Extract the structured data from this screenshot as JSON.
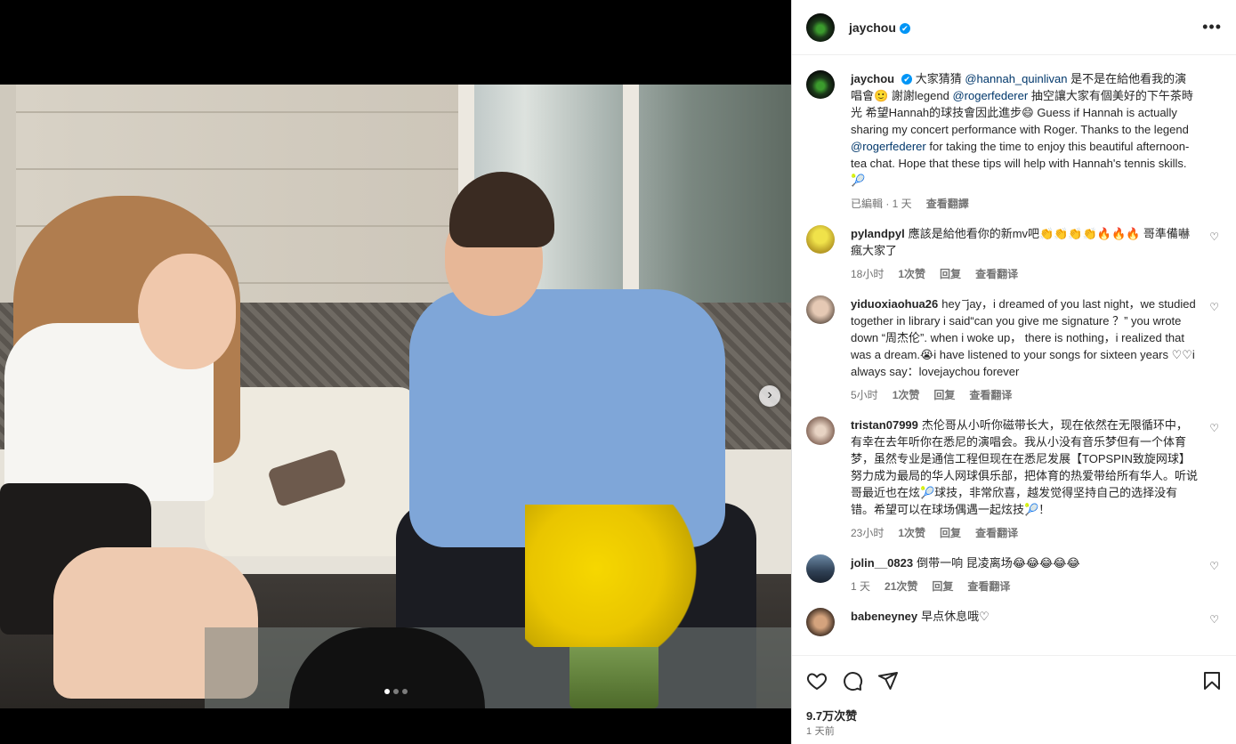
{
  "post": {
    "author": "jaychou",
    "verified_icon": "✔",
    "more_icon": "•••",
    "caption": {
      "username": "jaychou",
      "part1": " 大家猜猜 ",
      "mention1": "@hannah_quinlivan",
      "part2": " 是不是在給他看我的演唱會🙂 謝謝legend ",
      "mention2": "@rogerfederer",
      "part3": " 抽空讓大家有個美好的下午茶時光 希望Hannah的球技會因此進步😄 Guess if Hannah is actually sharing my concert performance with Roger. Thanks to the legend ",
      "mention3": "@rogerfederer",
      "part4": " for taking the time to enjoy this beautiful afternoon-tea chat. Hope that these tips will help with Hannah's tennis skills.🎾",
      "edited": "已編輯 · 1 天",
      "translate": "查看翻譯"
    },
    "comments": [
      {
        "username": "pylandpyl",
        "text": "應該是給他看你的新mv吧👏👏👏👏🔥🔥🔥 哥準備嚇瘋大家了",
        "time": "18小时",
        "likes": "1次赞",
        "reply": "回复",
        "translate": "查看翻译"
      },
      {
        "username": "yiduoxiaohua26",
        "text": "hey ̄ ̄jay，i dreamed of you last night，we studied together in library i said“can you give me signature ？” you wrote down “周杰伦”. when i woke up， there is nothing，i realized that was a dream.😭i have listened to your songs for sixteen years ♡♡i always say：lovejaychou forever",
        "time": "5小时",
        "likes": "1次赞",
        "reply": "回复",
        "translate": "查看翻译"
      },
      {
        "username": "tristan07999",
        "text": "杰伦哥从小听你磁带长大，现在依然在无限循环中，有幸在去年听你在悉尼的演唱会。我从小没有音乐梦但有一个体育梦，虽然专业是通信工程但现在在悉尼发展【TOPSPIN致旋网球】努力成为最局的华人网球俱乐部，把体育的热爱带给所有华人。听说哥最近也在炫🎾球技，非常欣喜，越发觉得坚持自己的选择没有错。希望可以在球场偶遇一起炫技🎾！",
        "time": "23小时",
        "likes": "1次赞",
        "reply": "回复",
        "translate": "查看翻译"
      },
      {
        "username": "jolin__0823",
        "text": "倒带一响 昆凌离场😂😂😂😂😂",
        "time": "1 天",
        "likes": "21次赞",
        "reply": "回复",
        "translate": "查看翻译"
      },
      {
        "username": "babeneyney",
        "text": "早点休息哦♡",
        "time": "",
        "likes": "",
        "reply": "",
        "translate": ""
      }
    ],
    "likes_count": "9.7万次赞",
    "posted": "1 天前"
  },
  "carousel": {
    "next_icon": "›",
    "total": 3,
    "current": 1
  }
}
